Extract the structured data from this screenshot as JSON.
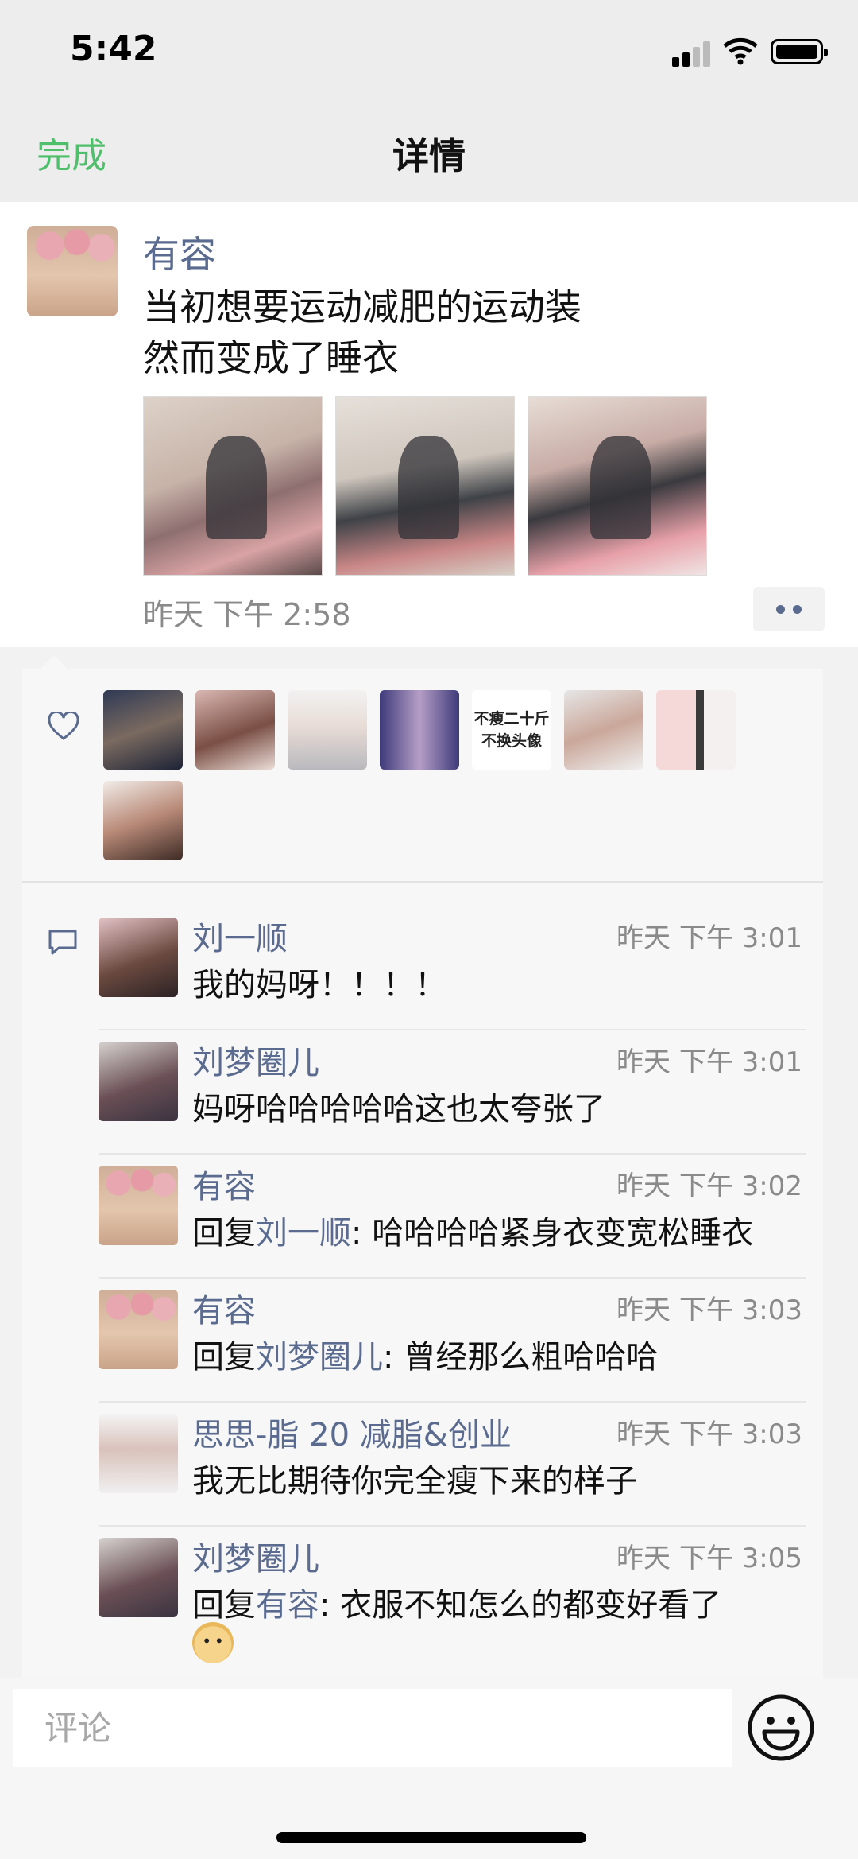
{
  "status_bar": {
    "time": "5:42"
  },
  "nav": {
    "done_label": "完成",
    "title": "详情"
  },
  "post": {
    "author": "有容",
    "text": "当初想要运动减肥的运动装\n然而变成了睡衣",
    "time": "昨天 下午 2:58"
  },
  "likes": {
    "liker_text": [
      "不瘦二十斤",
      "不换头像"
    ]
  },
  "comments": [
    {
      "name": "刘一顺",
      "time": "昨天 下午 3:01",
      "prefix": "",
      "reply_to": "",
      "text": "我的妈呀！！！！"
    },
    {
      "name": "刘梦圈儿",
      "time": "昨天 下午 3:01",
      "prefix": "",
      "reply_to": "",
      "text": "妈呀哈哈哈哈哈这也太夸张了"
    },
    {
      "name": "有容",
      "time": "昨天 下午 3:02",
      "prefix": "回复",
      "reply_to": "刘一顺",
      "text": ": 哈哈哈哈紧身衣变宽松睡衣"
    },
    {
      "name": "有容",
      "time": "昨天 下午 3:03",
      "prefix": "回复",
      "reply_to": "刘梦圈儿",
      "text": ": 曾经那么粗哈哈哈"
    },
    {
      "name": "思思-脂 20 减脂&创业",
      "time": "昨天 下午 3:03",
      "prefix": "",
      "reply_to": "",
      "text": "我无比期待你完全瘦下来的样子"
    },
    {
      "name": "刘梦圈儿",
      "time": "昨天 下午 3:05",
      "prefix": "回复",
      "reply_to": "有容",
      "text": ": 衣服不知怎么的都变好看了"
    }
  ],
  "input": {
    "placeholder": "评论"
  },
  "colors": {
    "accent_green": "#4fbf6b",
    "name_blue": "#5a6b8f"
  }
}
